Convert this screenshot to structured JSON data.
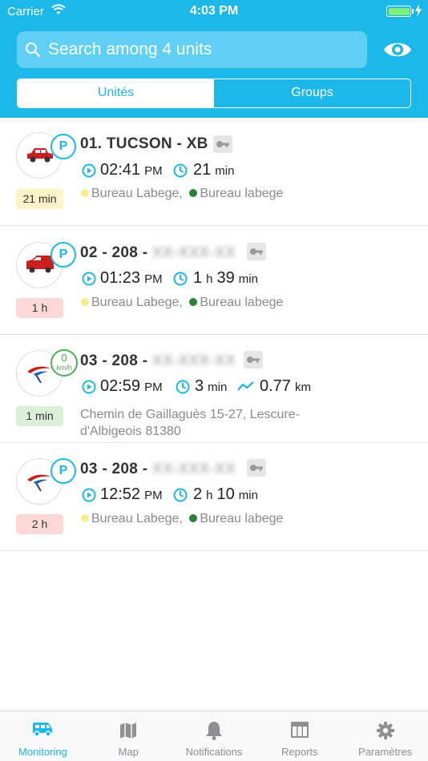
{
  "status_bar": {
    "carrier": "Carrier",
    "time": "4:03 PM"
  },
  "search": {
    "placeholder": "Search among 4 units"
  },
  "segments": {
    "units": "Unités",
    "groups": "Groups",
    "active": "units"
  },
  "units": [
    {
      "title": "01. TUCSON - XB",
      "title_hidden": "",
      "badge": "P",
      "duration": "21 min",
      "duration_color": "yellow",
      "time": "02:41",
      "time_ampm": "PM",
      "elapsed_a": "21",
      "elapsed_a_unit": "min",
      "geo_from": "Bureau Labege,",
      "geo_to": "Bureau labege"
    },
    {
      "title": "02 - 208 - ",
      "title_hidden": "XX-XXX-XX",
      "badge": "P",
      "duration": "1 h",
      "duration_color": "red",
      "time": "01:23",
      "time_ampm": "PM",
      "elapsed_a": "1",
      "elapsed_a_unit": "h",
      "elapsed_b": "39",
      "elapsed_b_unit": "min",
      "geo_from": "Bureau Labege,",
      "geo_to": "Bureau labege"
    },
    {
      "title": "03 - 208 - ",
      "title_hidden": "XX-XXX-XX",
      "speed_value": "0",
      "speed_unit": "km/h",
      "duration": "1 min",
      "duration_color": "green",
      "time": "02:59",
      "time_ampm": "PM",
      "elapsed_a": "3",
      "elapsed_a_unit": "min",
      "distance": "0.77",
      "distance_unit": "km",
      "address": "Chemin de Gaillaguès 15-27, Lescure-d'Albigeois 81380"
    },
    {
      "title": "03 - 208 - ",
      "title_hidden": "XX-XXX-XX",
      "badge": "P",
      "duration": "2 h",
      "duration_color": "red",
      "time": "12:52",
      "time_ampm": "PM",
      "elapsed_a": "2",
      "elapsed_a_unit": "h",
      "elapsed_b": "10",
      "elapsed_b_unit": "min",
      "geo_from": "Bureau Labege,",
      "geo_to": "Bureau labege"
    }
  ],
  "tabs": [
    {
      "label": "Monitoring",
      "icon": "van-icon",
      "active": true
    },
    {
      "label": "Map",
      "icon": "map-icon"
    },
    {
      "label": "Notifications",
      "icon": "bell-icon"
    },
    {
      "label": "Reports",
      "icon": "reports-icon"
    },
    {
      "label": "Paramètres",
      "icon": "gear-icon"
    }
  ],
  "colors": {
    "accent": "#1cb8ea",
    "parked_badge": "#1cb8ea",
    "moving_badge": "#4caf50",
    "duration_yellow": "#fcf3c6",
    "duration_red": "#fcd9d6",
    "duration_green": "#daf0d9",
    "geo_dot_yellow": "#f6ee8c",
    "geo_dot_green": "#2d7f3c"
  }
}
